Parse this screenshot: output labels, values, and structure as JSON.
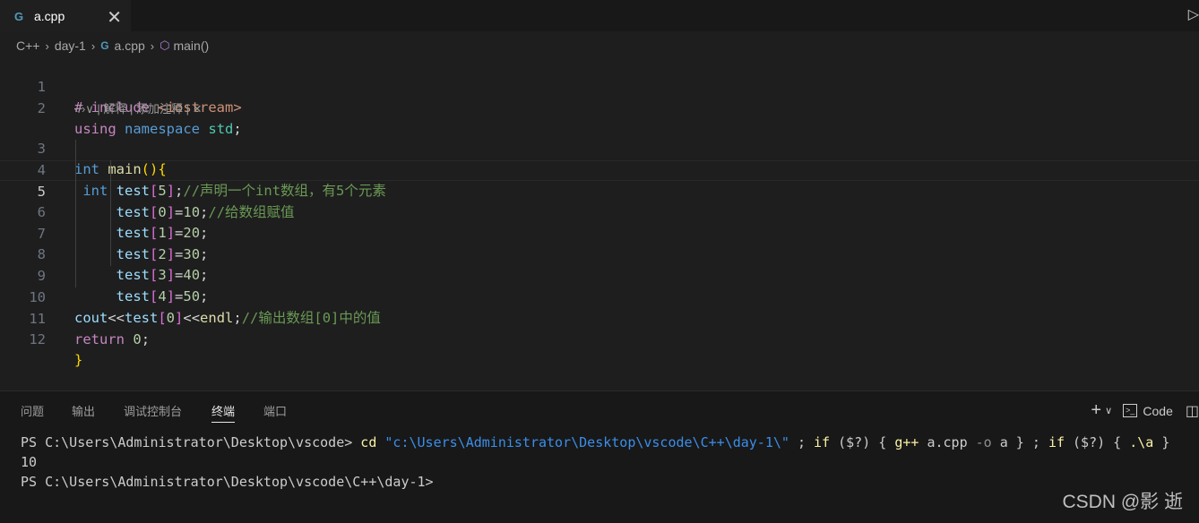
{
  "tab": {
    "icon": "cpp-file-icon",
    "icon_glyph": "G",
    "name": "a.cpp",
    "close": "✕"
  },
  "breadcrumb": {
    "items": [
      "C++",
      "day-1",
      "a.cpp",
      "main()"
    ],
    "sep": "›"
  },
  "codelens": {
    "icon": "‹/›∨",
    "text": " | 解释 | 添加注释 | ",
    "close": "✕"
  },
  "editor": {
    "active_line": 5,
    "line_numbers": [
      "1",
      "2",
      "3",
      "4",
      "5",
      "6",
      "7",
      "8",
      "9",
      "10",
      "11",
      "12"
    ],
    "lines": [
      "# include <iostream>",
      "using namespace std;",
      "int main(){",
      " int test[5];//声明一个int数组，有5个元素",
      "     test[0]=10;//给数组赋值",
      "     test[1]=20;",
      "     test[2]=30;",
      "     test[3]=40;",
      "     test[4]=50;",
      "cout<<test[0]<<endl;//输出数组[0]中的值",
      "return 0;",
      "}"
    ]
  },
  "panel": {
    "tabs": [
      "问题",
      "输出",
      "调试控制台",
      "终端",
      "端口"
    ],
    "active_tab": "终端",
    "tools": {
      "add": "+",
      "dropdown": "∨",
      "shell_label": "Code"
    }
  },
  "terminal": {
    "lines": [
      "PS C:\\Users\\Administrator\\Desktop\\vscode> cd \"c:\\Users\\Administrator\\Desktop\\vscode\\C++\\day-1\\\" ; if ($?) { g++ a.cpp -o a } ; if ($?) { .\\a }",
      "10",
      "PS C:\\Users\\Administrator\\Desktop\\vscode\\C++\\day-1>"
    ],
    "prompt1": "PS C:\\Users\\Administrator\\Desktop\\vscode> ",
    "cmd_cd": "cd",
    "cmd_path": "\"c:\\Users\\Administrator\\Desktop\\vscode\\C++\\day-1\\\"",
    "cmd_rest1": " ; ",
    "cmd_if1": "if",
    "cmd_cond1": " ($?) { ",
    "cmd_gpp": "g++",
    "cmd_args": " a.cpp ",
    "cmd_flag": "-o",
    "cmd_out": " a } ; ",
    "cmd_if2": "if",
    "cmd_cond2": " ($?) { ",
    "cmd_run": ".\\a",
    "cmd_end": " }",
    "output": "10",
    "prompt2": "PS C:\\Users\\Administrator\\Desktop\\vscode\\C++\\day-1>"
  },
  "watermark": "CSDN @影 逝",
  "colors": {
    "background": "#1e1e1e",
    "keyword": "#569cd6",
    "comment": "#6a9955",
    "bracket": "#ffd700"
  }
}
